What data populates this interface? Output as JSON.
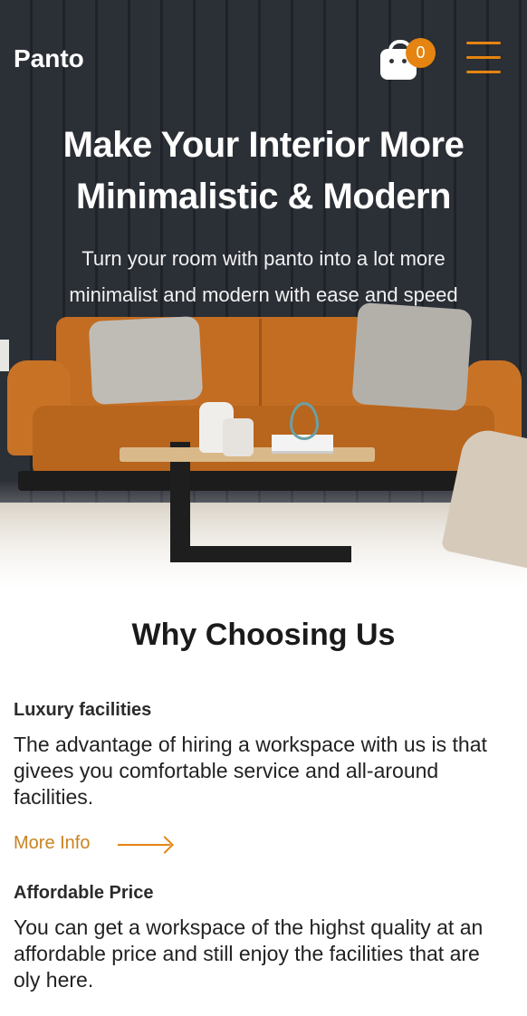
{
  "header": {
    "brand": "Panto",
    "cart_count": "0",
    "accent_color": "#e58411"
  },
  "hero": {
    "title_line1": "Make Your Interior More",
    "title_line2": "Minimalistic & Modern",
    "subtitle_line1": "Turn your room with panto into a lot more",
    "subtitle_line2": "minimalist and modern with ease and speed"
  },
  "why": {
    "title": "Why Choosing Us",
    "features": [
      {
        "title": "Luxury facilities",
        "description": "The advantage of hiring a workspace with us is that givees you comfortable service and all-around facilities.",
        "link": "More Info"
      },
      {
        "title": "Affordable Price",
        "description": "You can get a workspace of the highst quality at an affordable price and still enjoy the facilities that are oly here."
      }
    ]
  },
  "icons": {
    "cart": "shopping-bag-icon",
    "menu": "hamburger-menu-icon",
    "arrow": "arrow-right-icon"
  }
}
